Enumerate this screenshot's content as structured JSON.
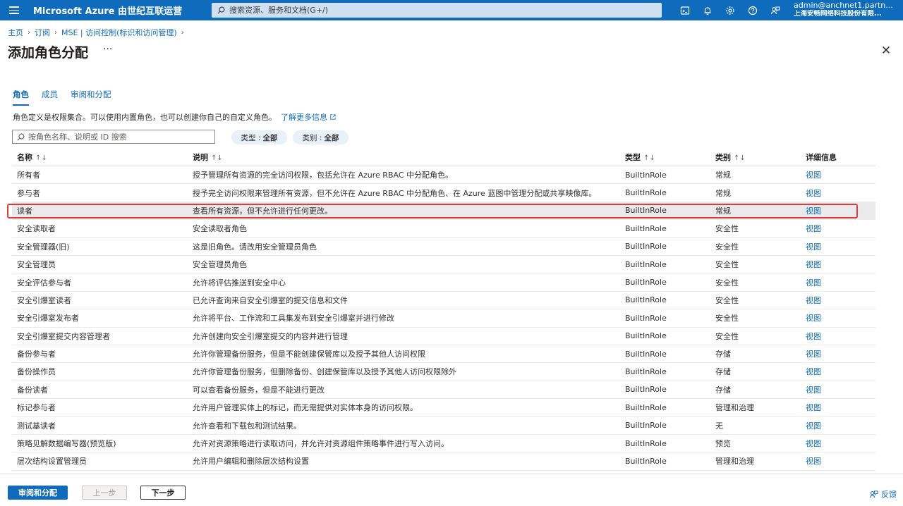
{
  "topbar": {
    "brand": "Microsoft Azure 由世纪互联运营",
    "search_placeholder": "搜索资源、服务和文档(G+/)",
    "icons": [
      "cloud-shell-icon",
      "bell-icon",
      "gear-icon",
      "help-icon",
      "feedback-icon"
    ],
    "user": "admin@anchnet1.partn...",
    "org": "上海安畅网络科技股份有限..."
  },
  "breadcrumb": [
    "主页",
    "订阅",
    "MSE | 访问控制(标识和访问管理)"
  ],
  "page": {
    "title": "添加角色分配",
    "more": "···",
    "close": "✕"
  },
  "tabs": [
    {
      "label": "角色",
      "active": true
    },
    {
      "label": "成员",
      "active": false
    },
    {
      "label": "审阅和分配",
      "active": false
    }
  ],
  "description": {
    "text": "角色定义是权限集合。可以使用内置角色，也可以创建你自己的自定义角色。",
    "link": "了解更多信息"
  },
  "filters": {
    "search_placeholder": "按角色名称、说明或 ID 搜索",
    "type_label": "类型 :",
    "type_value": "全部",
    "category_label": "类别 :",
    "category_value": "全部"
  },
  "table": {
    "headers": [
      "名称",
      "说明",
      "类型",
      "类别",
      "详细信息"
    ],
    "sort_glyph": "↑↓",
    "selected_index": 2,
    "rows": [
      {
        "name": "所有者",
        "desc": "授予管理所有资源的完全访问权限，包括允许在 Azure RBAC 中分配角色。",
        "type": "BuiltInRole",
        "category": "常规",
        "details": "视图"
      },
      {
        "name": "参与者",
        "desc": "授予完全访问权限来管理所有资源，但不允许在 Azure RBAC 中分配角色、在 Azure 蓝图中管理分配或共享映像库。",
        "type": "BuiltInRole",
        "category": "常规",
        "details": "视图"
      },
      {
        "name": "读者",
        "desc": "查看所有资源，但不允许进行任何更改。",
        "type": "BuiltInRole",
        "category": "常规",
        "details": "视图"
      },
      {
        "name": "安全读取者",
        "desc": "安全读取者角色",
        "type": "BuiltInRole",
        "category": "安全性",
        "details": "视图"
      },
      {
        "name": "安全管理器(旧)",
        "desc": "这是旧角色。请改用安全管理员角色",
        "type": "BuiltInRole",
        "category": "安全性",
        "details": "视图"
      },
      {
        "name": "安全管理员",
        "desc": "安全管理员角色",
        "type": "BuiltInRole",
        "category": "安全性",
        "details": "视图"
      },
      {
        "name": "安全评估参与者",
        "desc": "允许将评估推送到安全中心",
        "type": "BuiltInRole",
        "category": "安全性",
        "details": "视图"
      },
      {
        "name": "安全引爆室读者",
        "desc": "已允许查询来自安全引爆室的提交信息和文件",
        "type": "BuiltInRole",
        "category": "安全性",
        "details": "视图"
      },
      {
        "name": "安全引爆室发布者",
        "desc": "允许将平台、工作流和工具集发布到安全引爆室并进行修改",
        "type": "BuiltInRole",
        "category": "安全性",
        "details": "视图"
      },
      {
        "name": "安全引爆室提交内容管理者",
        "desc": "允许创建向安全引爆室提交的内容并进行管理",
        "type": "BuiltInRole",
        "category": "安全性",
        "details": "视图"
      },
      {
        "name": "备份参与者",
        "desc": "允许你管理备份服务，但是不能创建保管库以及授予其他人访问权限",
        "type": "BuiltInRole",
        "category": "存储",
        "details": "视图"
      },
      {
        "name": "备份操作员",
        "desc": "允许你管理备份服务，但删除备份、创建保管库以及授予其他人访问权限除外",
        "type": "BuiltInRole",
        "category": "存储",
        "details": "视图"
      },
      {
        "name": "备份读者",
        "desc": "可以查看备份服务，但是不能进行更改",
        "type": "BuiltInRole",
        "category": "存储",
        "details": "视图"
      },
      {
        "name": "标记参与者",
        "desc": "允许用户管理实体上的标记，而无需提供对实体本身的访问权限。",
        "type": "BuiltInRole",
        "category": "管理和治理",
        "details": "视图"
      },
      {
        "name": "测试基读者",
        "desc": "允许查看和下载包和测试结果。",
        "type": "BuiltInRole",
        "category": "无",
        "details": "视图"
      },
      {
        "name": "策略见解数据编写器(预览版)",
        "desc": "允许对资源策略进行读取访问，并允许对资源组件策略事件进行写入访问。",
        "type": "BuiltInRole",
        "category": "预览",
        "details": "视图"
      },
      {
        "name": "层次结构设置管理员",
        "desc": "允许用户编辑和删除层次结构设置",
        "type": "BuiltInRole",
        "category": "管理和治理",
        "details": "视图"
      }
    ]
  },
  "footer": {
    "review_assign": "审阅和分配",
    "previous": "上一步",
    "next": "下一步",
    "feedback": "反馈"
  }
}
